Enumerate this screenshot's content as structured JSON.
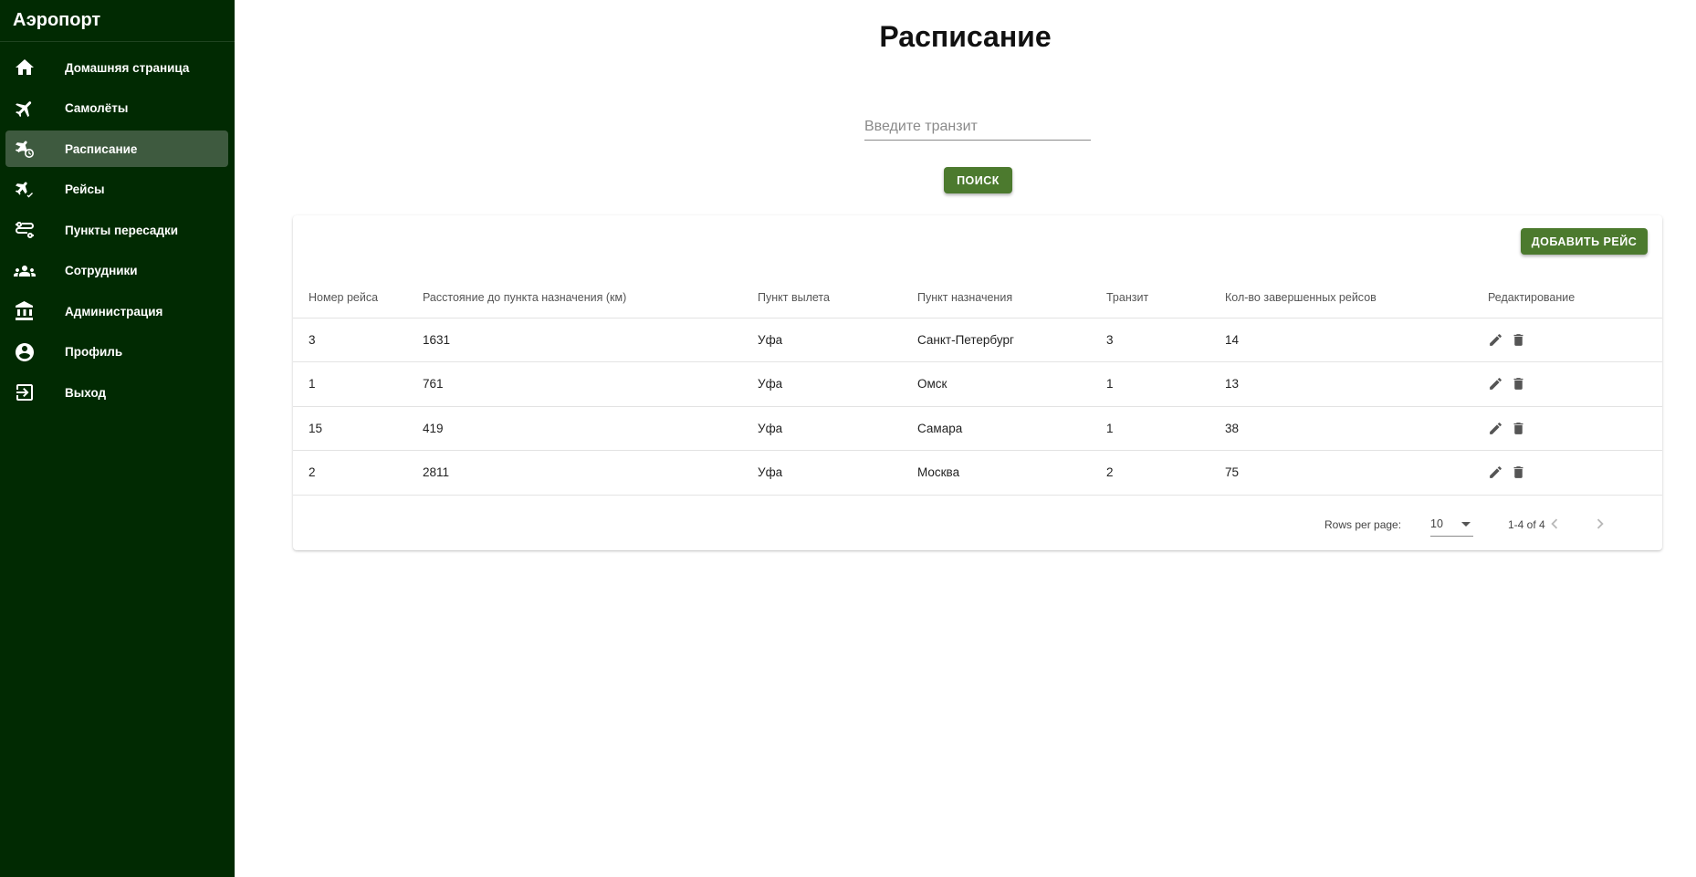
{
  "app": {
    "title": "Аэропорт"
  },
  "sidebar": {
    "items": [
      {
        "label": "Домашняя страница",
        "icon": "home-icon",
        "active": false
      },
      {
        "label": "Самолёты",
        "icon": "airplane-icon",
        "active": false
      },
      {
        "label": "Расписание",
        "icon": "airplane-clock-icon",
        "active": true
      },
      {
        "label": "Рейсы",
        "icon": "airplane-check-icon",
        "active": false
      },
      {
        "label": "Пункты пересадки",
        "icon": "route-icon",
        "active": false
      },
      {
        "label": "Сотрудники",
        "icon": "people-icon",
        "active": false
      },
      {
        "label": "Администрация",
        "icon": "institution-icon",
        "active": false
      },
      {
        "label": "Профиль",
        "icon": "account-circle-icon",
        "active": false
      },
      {
        "label": "Выход",
        "icon": "logout-icon",
        "active": false
      }
    ]
  },
  "page": {
    "title": "Расписание"
  },
  "search": {
    "placeholder": "Введите транзит",
    "value": "",
    "button_label": "ПОИСК"
  },
  "table": {
    "add_button_label": "ДОБАВИТЬ РЕЙС",
    "columns": [
      "Номер рейса",
      "Расстояние до пункта назначения (км)",
      "Пункт вылета",
      "Пункт назначения",
      "Транзит",
      "Кол-во завершенных рейсов",
      "Редактирование"
    ],
    "rows": [
      [
        "3",
        "1631",
        "Уфа",
        "Санкт-Петербург",
        "3",
        "14"
      ],
      [
        "1",
        "761",
        "Уфа",
        "Омск",
        "1",
        "13"
      ],
      [
        "15",
        "419",
        "Уфа",
        "Самара",
        "1",
        "38"
      ],
      [
        "2",
        "2811",
        "Уфа",
        "Москва",
        "2",
        "75"
      ]
    ]
  },
  "pagination": {
    "rows_per_page_label": "Rows per page:",
    "rows_per_page": "10",
    "range": "1-4 of 4"
  },
  "colors": {
    "sidebar_bg": "#012a02",
    "sidebar_active": "#3e5a3f",
    "accent": "#4c7a2e"
  }
}
